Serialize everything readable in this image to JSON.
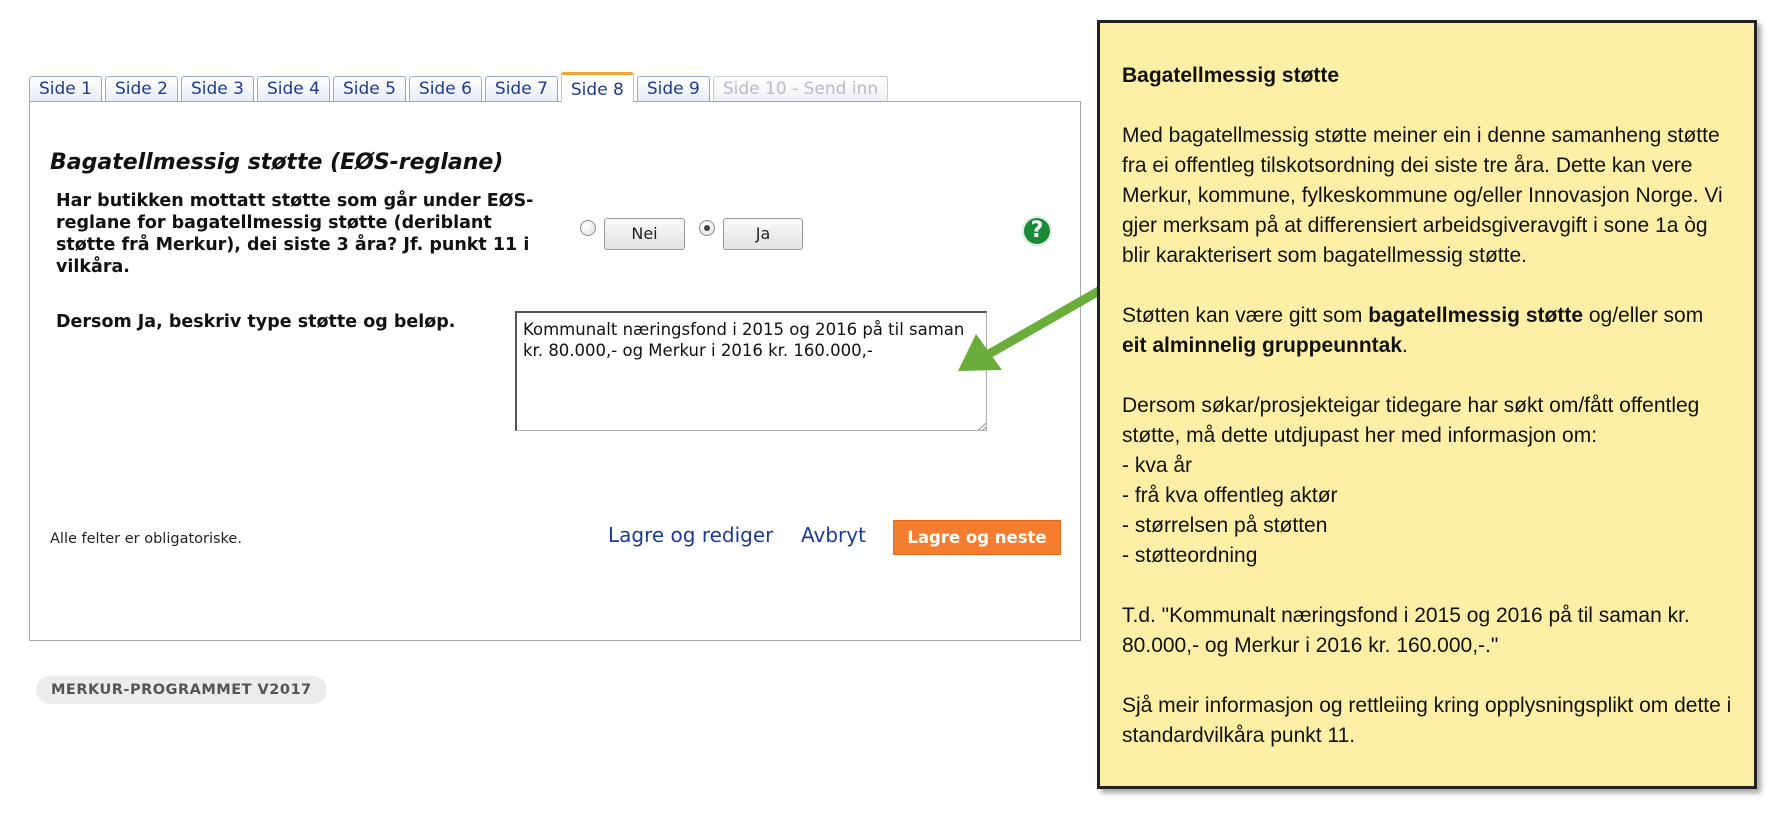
{
  "tabs": [
    {
      "label": "Side 1",
      "state": "normal"
    },
    {
      "label": "Side 2",
      "state": "normal"
    },
    {
      "label": "Side 3",
      "state": "normal"
    },
    {
      "label": "Side 4",
      "state": "normal"
    },
    {
      "label": "Side 5",
      "state": "normal"
    },
    {
      "label": "Side 6",
      "state": "normal"
    },
    {
      "label": "Side 7",
      "state": "normal"
    },
    {
      "label": "Side 8",
      "state": "active"
    },
    {
      "label": "Side 9",
      "state": "normal"
    },
    {
      "label": "Side 10 - Send inn",
      "state": "disabled"
    }
  ],
  "form": {
    "section_title": "Bagatellmessig støtte (EØS-reglane)",
    "question": "Har butikken mottatt støtte som går under EØS-reglane for bagatellmessig støtte (deriblant støtte frå Merkur), dei siste 3 åra? Jf. punkt 11 i vilkåra.",
    "option_no": "Nei",
    "option_yes": "Ja",
    "selected_option": "Ja",
    "help_icon": "?",
    "describe_label": "Dersom Ja, beskriv type støtte og beløp.",
    "describe_value": "Kommunalt næringsfond i 2015 og 2016 på til saman kr. 80.000,- og Merkur i 2016 kr. 160.000,-",
    "required_note": "Alle felter er obligatoriske.",
    "save_edit_label": "Lagre og rediger",
    "cancel_label": "Avbryt",
    "save_next_label": "Lagre og neste"
  },
  "footer": {
    "badge": "MERKUR-PROGRAMMET V2017"
  },
  "callout": {
    "title": "Bagatellmessig støtte",
    "para1": "Med bagatellmessig støtte meiner ein i denne samanheng støtte fra ei offentleg tilskotsordning dei siste tre åra. Dette kan vere Merkur, kommune, fylkeskommune og/eller Innovasjon Norge. Vi gjer merksam på at differensiert arbeidsgiveravgift i sone 1a òg blir karakterisert som bagatellmessig støtte.",
    "para2_prefix": "Støtten kan være gitt som ",
    "para2_bold1": "bagatellmessig støtte",
    "para2_middle": " og/eller som ",
    "para2_bold2": "eit alminnelig gruppeunntak",
    "para2_suffix": ".",
    "para3": "Dersom søkar/prosjekteigar tidegare har søkt om/fått offentleg støtte, må dette utdjupast her med informasjon om:",
    "list": [
      "kva år",
      "frå kva offentleg aktør",
      "størrelsen på støtten",
      "støtteordning"
    ],
    "para4": "T.d. \"Kommunalt næringsfond i 2015 og 2016 på til saman kr. 80.000,- og Merkur i 2016 kr. 160.000,-.\"",
    "para5": "Sjå meir informasjon og rettleiing kring opplysningsplikt om dette i standardvilkåra punkt 11."
  },
  "colors": {
    "tab_text": "#1d3b93",
    "active_tab_border": "#f2a33a",
    "primary_button": "#f47d30",
    "help_icon": "#1b8a36",
    "callout_bg": "#fdf0a6",
    "arrow": "#6aad3a"
  }
}
